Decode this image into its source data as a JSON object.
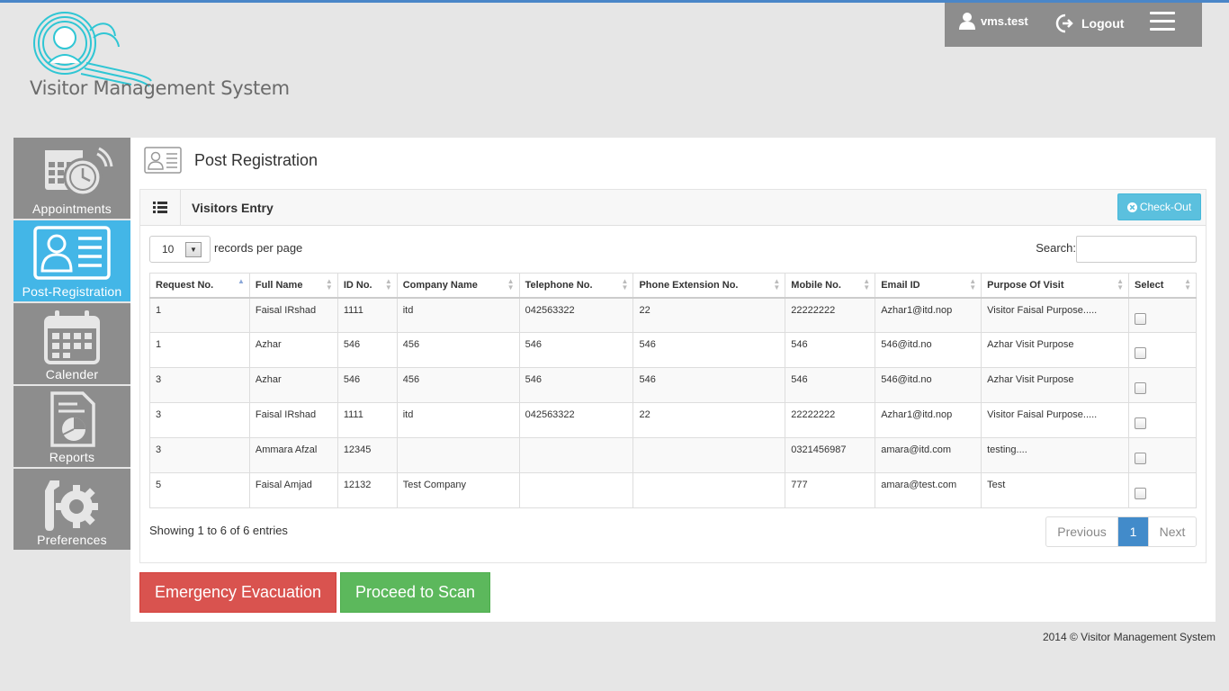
{
  "app": {
    "title": "Visitor Management System",
    "footer": "2014 © Visitor Management System"
  },
  "userbar": {
    "username": "vms.test",
    "logout_label": "Logout"
  },
  "sidebar": {
    "items": [
      {
        "label": "Appointments",
        "icon": "appointments-icon",
        "active": false
      },
      {
        "label": "Post-Registration",
        "icon": "registration-card-icon",
        "active": true
      },
      {
        "label": "Calender",
        "icon": "calendar-icon",
        "active": false
      },
      {
        "label": "Reports",
        "icon": "reports-icon",
        "active": false
      },
      {
        "label": "Preferences",
        "icon": "preferences-icon",
        "active": false
      }
    ]
  },
  "page": {
    "title": "Post Registration"
  },
  "panel": {
    "title": "Visitors Entry",
    "checkout_label": "Check-Out",
    "records_per_page": "10",
    "records_label": "records per page",
    "search_label": "Search:",
    "search_value": ""
  },
  "table": {
    "columns": [
      "Request No.",
      "Full Name",
      "ID No.",
      "Company Name",
      "Telephone No.",
      "Phone Extension No.",
      "Mobile No.",
      "Email ID",
      "Purpose Of Visit",
      "Select"
    ],
    "rows": [
      [
        "1",
        "Faisal IRshad",
        "1111",
        "itd",
        "042563322",
        "22",
        "22222222",
        "Azhar1@itd.nop",
        "Visitor Faisal Purpose....."
      ],
      [
        "1",
        "Azhar",
        "546",
        "456",
        "546",
        "546",
        "546",
        "546@itd.no",
        "Azhar Visit Purpose"
      ],
      [
        "3",
        "Azhar",
        "546",
        "456",
        "546",
        "546",
        "546",
        "546@itd.no",
        "Azhar Visit Purpose"
      ],
      [
        "3",
        "Faisal IRshad",
        "1111",
        "itd",
        "042563322",
        "22",
        "22222222",
        "Azhar1@itd.nop",
        "Visitor Faisal Purpose....."
      ],
      [
        "3",
        "Ammara Afzal",
        "12345",
        "",
        "",
        "",
        "0321456987",
        "amara@itd.com",
        "testing...."
      ],
      [
        "5",
        "Faisal Amjad",
        "12132",
        "Test Company",
        "",
        "",
        "777",
        "amara@test.com",
        "Test"
      ]
    ],
    "info": "Showing 1 to 6 of 6 entries"
  },
  "pagination": {
    "previous": "Previous",
    "current": "1",
    "next": "Next"
  },
  "actions": {
    "emergency_label": "Emergency Evacuation",
    "scan_label": "Proceed to Scan"
  },
  "colors": {
    "accent": "#43b6e7",
    "sidebar": "#8d8d8d",
    "danger": "#d9534f",
    "success": "#5cb85c",
    "info": "#5bc0de",
    "primary": "#428bca"
  }
}
